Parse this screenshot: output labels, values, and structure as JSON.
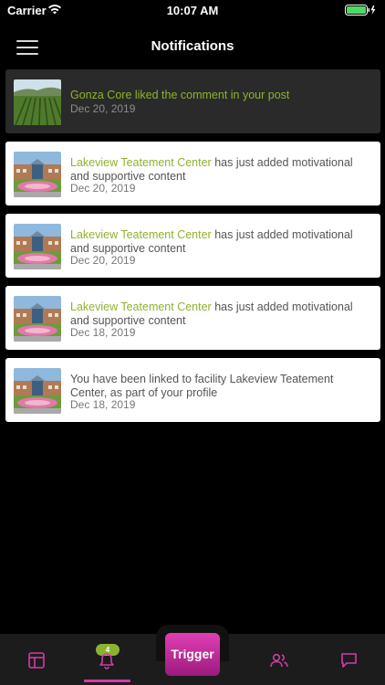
{
  "status_bar": {
    "carrier": "Carrier",
    "time": "10:07 AM"
  },
  "header": {
    "title": "Notifications"
  },
  "notifications": [
    {
      "pre": "",
      "actor": "",
      "text": "Gonza Core liked the comment in your post",
      "date": "Dec 20, 2019",
      "thumb": "vineyard",
      "highlight": true
    },
    {
      "pre": "",
      "actor": "Lakeview Teatement Center",
      "text": " has just added motivational and supportive content",
      "date": "Dec 20, 2019",
      "thumb": "building",
      "highlight": false
    },
    {
      "pre": "",
      "actor": "Lakeview Teatement Center",
      "text": " has just added motivational and supportive content",
      "date": "Dec 20, 2019",
      "thumb": "building",
      "highlight": false
    },
    {
      "pre": "",
      "actor": "Lakeview Teatement Center",
      "text": " has just added motivational and supportive content",
      "date": "Dec 18, 2019",
      "thumb": "building",
      "highlight": false
    },
    {
      "pre": "",
      "actor": "",
      "text": "You have been linked to facility Lakeview Teatement Center, as part of your profile",
      "date": "Dec 18, 2019",
      "thumb": "building",
      "highlight": false
    }
  ],
  "tab_bar": {
    "notification_badge": "4",
    "trigger_label": "Trigger",
    "tabs": [
      "dashboard-icon",
      "bell-icon",
      "people-icon",
      "chat-icon"
    ],
    "accent": "#d43aaa",
    "badge_color": "#8db32e"
  }
}
